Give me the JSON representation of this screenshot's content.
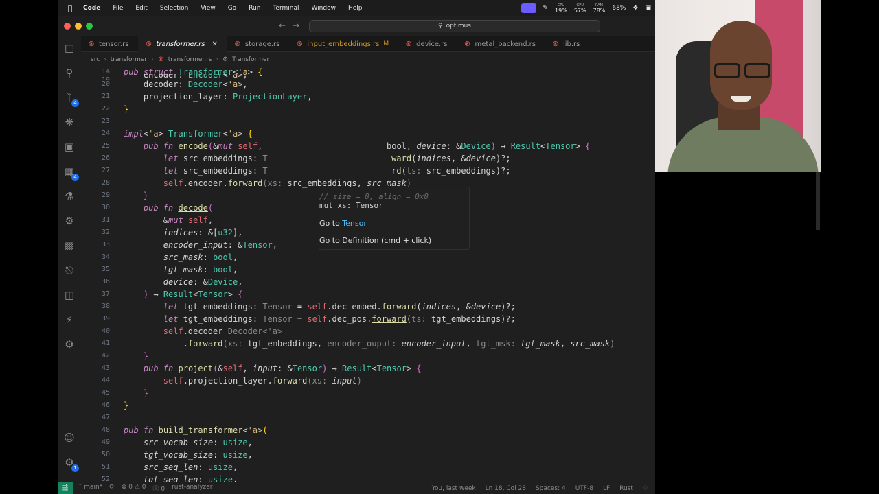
{
  "menubar": {
    "app": "Code",
    "items": [
      "File",
      "Edit",
      "Selection",
      "View",
      "Go",
      "Run",
      "Terminal",
      "Window",
      "Help"
    ],
    "cpu": {
      "label": "CPU",
      "value": "19%"
    },
    "gpu": {
      "label": "GPU",
      "value": "57%"
    },
    "ram": {
      "label": "RAM",
      "value": "78%"
    },
    "battery": "68%"
  },
  "titlebar": {
    "search": "optimus"
  },
  "tabs": [
    {
      "label": "tensor.rs",
      "active": false
    },
    {
      "label": "transformer.rs",
      "active": true
    },
    {
      "label": "storage.rs",
      "active": false
    },
    {
      "label": "input_embeddings.rs",
      "active": false,
      "modified": "M"
    },
    {
      "label": "device.rs",
      "active": false
    },
    {
      "label": "metal_backend.rs",
      "active": false
    },
    {
      "label": "lib.rs",
      "active": false
    }
  ],
  "breadcrumbs": [
    "src",
    "transformer",
    "transformer.rs",
    "Transformer"
  ],
  "activity_badges": {
    "source_control": "4",
    "extensions": "4",
    "manage": "1"
  },
  "hover": {
    "comment": "// size = 8, align = 0x8",
    "signature": "mut xs: Tensor",
    "goto_prefix": "Go to",
    "goto_target": "Tensor",
    "goto_definition": "Go to Definition (cmd + click)"
  },
  "line_numbers": [
    "14",
    "19",
    "20",
    "21",
    "22",
    "23",
    "24",
    "25",
    "26",
    "27",
    "28",
    "29",
    "30",
    "31",
    "32",
    "33",
    "34",
    "35",
    "36",
    "37",
    "38",
    "39",
    "40",
    "41",
    "42",
    "43",
    "44",
    "45",
    "46",
    "47",
    "48",
    "49",
    "50",
    "51",
    "52"
  ],
  "statusbar": {
    "branch": "main*",
    "errors": "0",
    "warnings": "0",
    "info": "0",
    "lsp": "rust-analyzer",
    "blame": "You, last week",
    "position": "Ln 18, Col 28",
    "spaces": "Spaces: 4",
    "encoding": "UTF-8",
    "eol": "LF",
    "language": "Rust"
  }
}
